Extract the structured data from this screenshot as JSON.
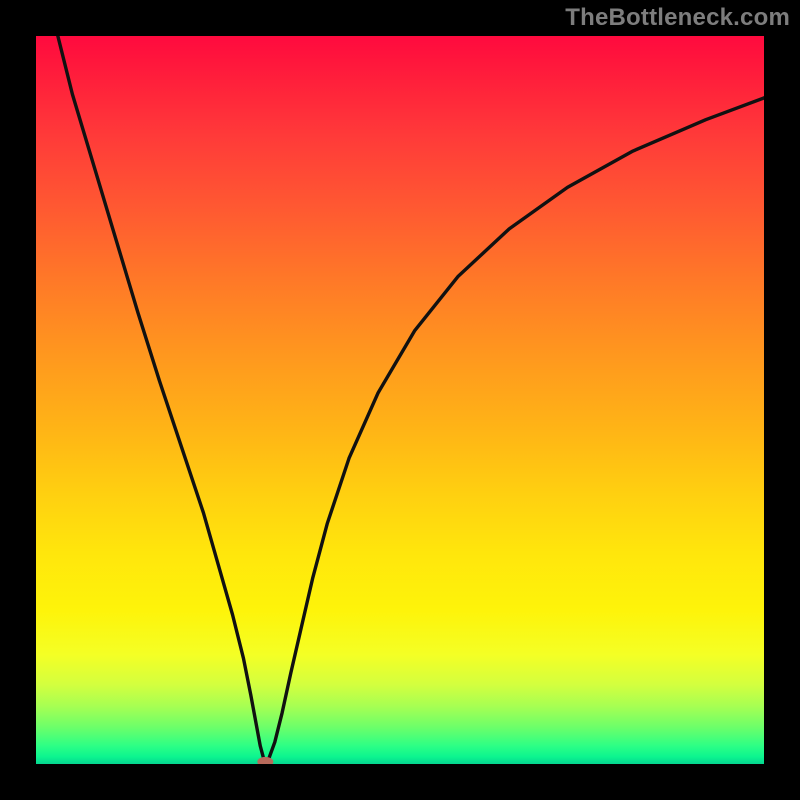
{
  "watermark": "TheBottleneck.com",
  "chart_data": {
    "type": "line",
    "title": "",
    "xlabel": "",
    "ylabel": "",
    "xlim": [
      0,
      100
    ],
    "ylim": [
      0,
      100
    ],
    "series": [
      {
        "name": "curve",
        "x": [
          3,
          5,
          8,
          11,
          14,
          17,
          20,
          23,
          25,
          27,
          28.5,
          29.5,
          30.3,
          30.8,
          31.2,
          31.5,
          32,
          32.8,
          33.8,
          35,
          36.5,
          38,
          40,
          43,
          47,
          52,
          58,
          65,
          73,
          82,
          92,
          100
        ],
        "y": [
          100,
          92,
          82,
          72,
          62,
          52.5,
          43.5,
          34.5,
          27.5,
          20.5,
          14.5,
          9.5,
          5.2,
          2.5,
          1,
          0.2,
          0.8,
          3,
          7,
          12.5,
          19,
          25.5,
          33,
          42,
          51,
          59.5,
          67,
          73.5,
          79.2,
          84.2,
          88.5,
          91.5
        ]
      }
    ],
    "marker": {
      "x": 31.5,
      "y": 0.3
    },
    "background_gradient": {
      "stops": [
        {
          "pos": 0,
          "color": "#ff0a3e"
        },
        {
          "pos": 50,
          "color": "#ff981e"
        },
        {
          "pos": 78,
          "color": "#fef40a"
        },
        {
          "pos": 100,
          "color": "#05d690"
        }
      ]
    }
  }
}
